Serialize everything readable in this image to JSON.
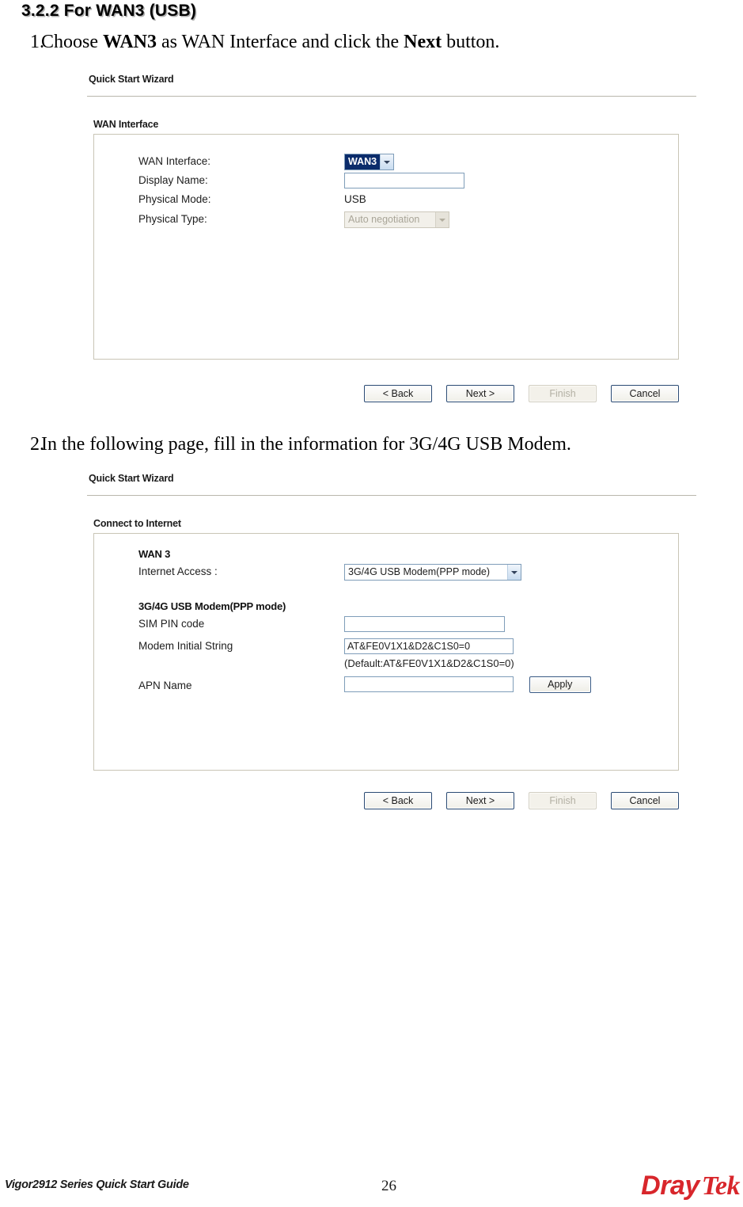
{
  "document": {
    "section_heading": "3.2.2 For WAN3 (USB)",
    "steps": [
      {
        "number": "1.",
        "text_parts": [
          "Choose ",
          "WAN3",
          " as WAN Interface and click the ",
          "Next",
          " button."
        ],
        "plain": "Choose WAN3 as WAN Interface and click the Next button."
      },
      {
        "number": "2.",
        "plain": "In the following page, fill in the information for 3G/4G USB Modem."
      }
    ],
    "footer": {
      "left_text": "Vigor2912 Series Quick Start Guide",
      "page_number": "26",
      "logo_part1": "Dray",
      "logo_part2": "Tek",
      "logo_color": "#d8262b"
    }
  },
  "screenshot1": {
    "title": "Quick Start Wizard",
    "group_title": "WAN Interface",
    "rows": [
      {
        "label": "WAN Interface:",
        "value": "WAN3",
        "type": "select",
        "state": "selected-highlight"
      },
      {
        "label": "Display Name:",
        "value": "",
        "type": "text",
        "placeholder": ""
      },
      {
        "label": "Physical Mode:",
        "value": "USB",
        "type": "static"
      },
      {
        "label": "Physical Type:",
        "value": "Auto negotiation",
        "type": "select",
        "state": "disabled"
      }
    ],
    "buttons": [
      {
        "label": "< Back",
        "state": "enabled"
      },
      {
        "label": "Next >",
        "state": "enabled"
      },
      {
        "label": "Finish",
        "state": "disabled"
      },
      {
        "label": "Cancel",
        "state": "enabled"
      }
    ]
  },
  "screenshot2": {
    "title": "Quick Start Wizard",
    "group_title": "Connect to Internet",
    "wan_label": "WAN 3",
    "internet_access": {
      "label": "Internet Access :",
      "value": "3G/4G USB Modem(PPP mode)"
    },
    "modem_section_title": "3G/4G USB Modem(PPP mode)",
    "fields": [
      {
        "label": "SIM PIN code",
        "value": ""
      },
      {
        "label": "Modem Initial String",
        "value": "AT&FE0V1X1&D2&C1S0=0"
      },
      {
        "label": "APN Name",
        "value": ""
      }
    ],
    "default_hint": "(Default:AT&FE0V1X1&D2&C1S0=0)",
    "apply_label": "Apply",
    "buttons": [
      {
        "label": "< Back",
        "state": "enabled"
      },
      {
        "label": "Next >",
        "state": "enabled"
      },
      {
        "label": "Finish",
        "state": "disabled"
      },
      {
        "label": "Cancel",
        "state": "enabled"
      }
    ]
  }
}
